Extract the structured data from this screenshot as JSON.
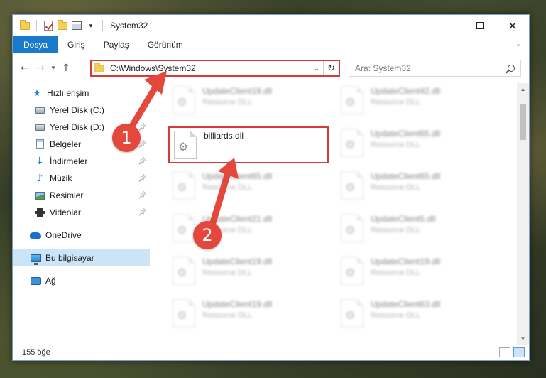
{
  "window": {
    "title": "System32",
    "controls": {
      "minimize": "minimize",
      "maximize": "maximize",
      "close": "✕"
    }
  },
  "ribbon": {
    "tabs": [
      "Dosya",
      "Giriş",
      "Paylaş",
      "Görünüm"
    ]
  },
  "address": {
    "path": "C:\\Windows\\System32",
    "search_placeholder": "Ara: System32"
  },
  "sidebar": {
    "items": [
      {
        "label": "Hızlı erişim",
        "icon": "star-icon",
        "pinned": false,
        "selected": false
      },
      {
        "label": "Yerel Disk (C:)",
        "icon": "drive-icon",
        "pinned": true,
        "selected": false
      },
      {
        "label": "Yerel Disk (D:)",
        "icon": "drive-icon",
        "pinned": true,
        "selected": false
      },
      {
        "label": "Belgeler",
        "icon": "documents-icon",
        "pinned": true,
        "selected": false
      },
      {
        "label": "İndirmeler",
        "icon": "download-icon",
        "pinned": true,
        "selected": false
      },
      {
        "label": "Müzik",
        "icon": "music-icon",
        "pinned": true,
        "selected": false
      },
      {
        "label": "Resimler",
        "icon": "pictures-icon",
        "pinned": true,
        "selected": false
      },
      {
        "label": "Videolar",
        "icon": "videos-icon",
        "pinned": true,
        "selected": false
      },
      {
        "label": "OneDrive",
        "icon": "onedrive-icon",
        "pinned": false,
        "selected": false
      },
      {
        "label": "Bu bilgisayar",
        "icon": "this-pc-icon",
        "pinned": false,
        "selected": true
      },
      {
        "label": "Ağ",
        "icon": "network-icon",
        "pinned": false,
        "selected": false
      }
    ]
  },
  "files": [
    {
      "name": "UpdateClient19.dll",
      "type": "Resource DLL",
      "blurred": true
    },
    {
      "name": "UpdateClient42.dll",
      "type": "Resource DLL",
      "blurred": true
    },
    {
      "name": "billiards.dll",
      "type": "",
      "blurred": false
    },
    {
      "name": "UpdateClient65.dll",
      "type": "Resource DLL",
      "blurred": true
    },
    {
      "name": "UpdateClient65.dll",
      "type": "Resource DLL",
      "blurred": true
    },
    {
      "name": "UpdateClient65.dll",
      "type": "Resource DLL",
      "blurred": true
    },
    {
      "name": "UpdateClient21.dll",
      "type": "Resource DLL",
      "blurred": true
    },
    {
      "name": "UpdateClient5.dll",
      "type": "Resource DLL",
      "blurred": true
    },
    {
      "name": "UpdateClient19.dll",
      "type": "Resource DLL",
      "blurred": true
    },
    {
      "name": "UpdateClient19.dll",
      "type": "Resource DLL",
      "blurred": true
    },
    {
      "name": "UpdateClient19.dll",
      "type": "Resource DLL",
      "blurred": true
    },
    {
      "name": "UpdateClient63.dll",
      "type": "Resource DLL",
      "blurred": true
    }
  ],
  "status": {
    "item_count": "155 öğe"
  },
  "annotations": {
    "step1": "1",
    "step2": "2",
    "color": "#e4473b"
  }
}
